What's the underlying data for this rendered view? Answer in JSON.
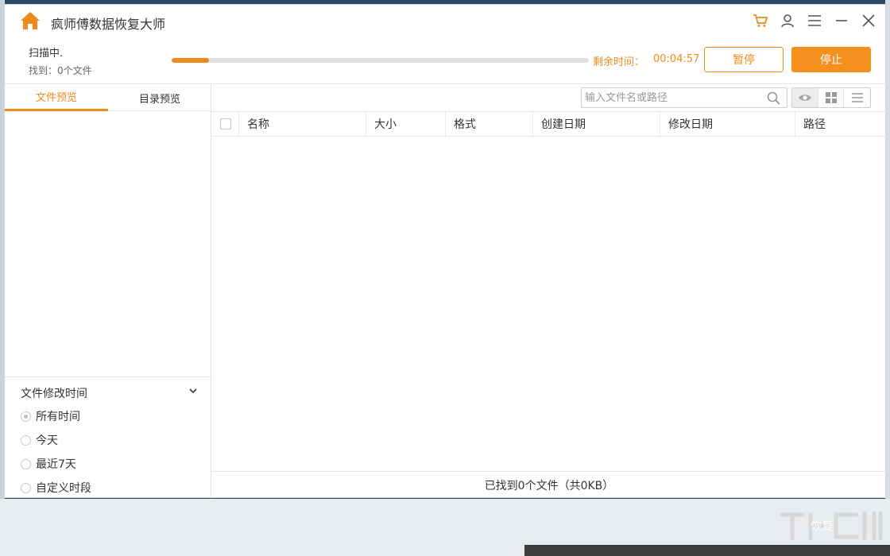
{
  "app": {
    "title": "疯师傅数据恢复大师"
  },
  "scan": {
    "status": "扫描中.",
    "found": "找到：0个文件",
    "progress_pct": 9,
    "remaining_label": "剩余时间：",
    "remaining_time": "00:04:57",
    "pause_label": "暂停",
    "stop_label": "停止"
  },
  "sidebar": {
    "tabs": [
      {
        "label": "文件预览",
        "active": true
      },
      {
        "label": "目录预览",
        "active": false
      }
    ],
    "filter": {
      "title": "文件修改时间",
      "options": [
        {
          "label": "所有时间",
          "checked": true
        },
        {
          "label": "今天",
          "checked": false
        },
        {
          "label": "最近7天",
          "checked": false
        },
        {
          "label": "自定义时段",
          "checked": false
        }
      ]
    }
  },
  "search": {
    "placeholder": "输入文件名或路径"
  },
  "table": {
    "columns": [
      "名称",
      "大小",
      "格式",
      "创建日期",
      "修改日期",
      "路径"
    ]
  },
  "status": {
    "summary": "已找到0个文件（共0KB）"
  },
  "footer": {
    "recover_label": "恢复"
  },
  "colors": {
    "accent": "#f08a1c",
    "button_fill": "#f5901e"
  }
}
